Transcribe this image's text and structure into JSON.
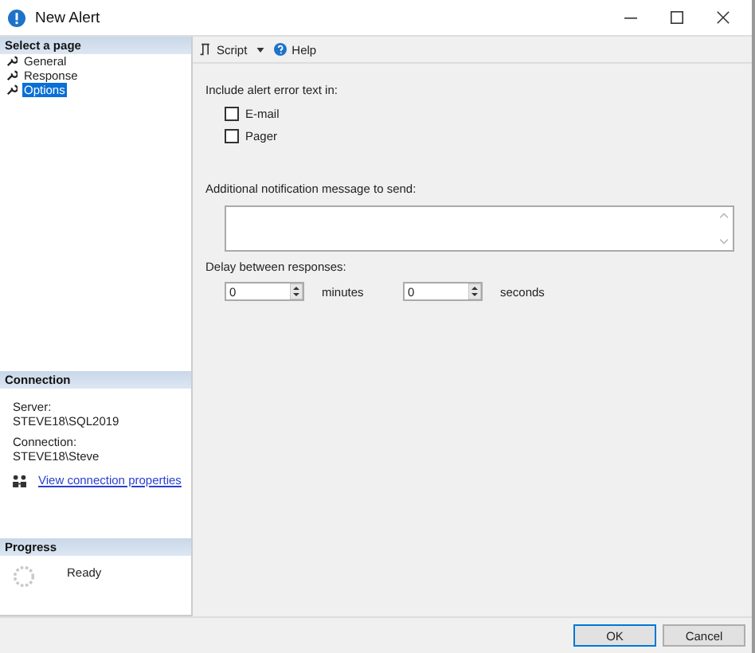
{
  "window": {
    "title": "New Alert"
  },
  "sidebar": {
    "header": "Select a page",
    "items": [
      {
        "label": "General",
        "selected": false
      },
      {
        "label": "Response",
        "selected": false
      },
      {
        "label": "Options",
        "selected": true
      }
    ]
  },
  "connection": {
    "header": "Connection",
    "server_label": "Server:",
    "server": "STEVE18\\SQL2019",
    "connection_label": "Connection:",
    "connection": "STEVE18\\Steve",
    "link": "View connection properties"
  },
  "progress": {
    "header": "Progress",
    "status": "Ready"
  },
  "toolbar": {
    "buttons": [
      {
        "kind": "script",
        "label": "Script"
      },
      {
        "kind": "help",
        "label": "Help"
      }
    ]
  },
  "options": {
    "include_label": "Include alert error text in:",
    "checkboxes": [
      {
        "label": "E-mail",
        "checked": false
      },
      {
        "label": "Pager",
        "checked": false
      }
    ],
    "message_label": "Additional notification message to send:",
    "delay_label": "Delay between responses:",
    "spinners": [
      {
        "value": "0",
        "unit": "minutes"
      },
      {
        "value": "0",
        "unit": "seconds"
      }
    ]
  },
  "footer": {
    "buttons": [
      {
        "label": "OK",
        "default": true
      },
      {
        "label": "Cancel",
        "default": false
      }
    ]
  }
}
